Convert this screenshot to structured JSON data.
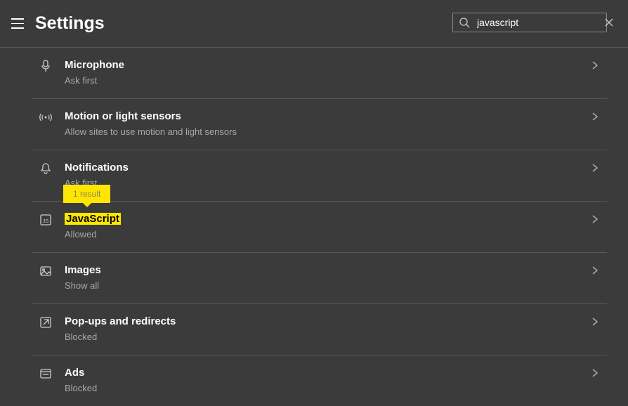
{
  "header": {
    "title": "Settings"
  },
  "search": {
    "value": "javascript"
  },
  "tooltip": {
    "text": "1 result"
  },
  "rows": [
    {
      "title": "Microphone",
      "subtitle": "Ask first"
    },
    {
      "title": "Motion or light sensors",
      "subtitle": "Allow sites to use motion and light sensors"
    },
    {
      "title": "Notifications",
      "subtitle": "Ask first"
    },
    {
      "title": "JavaScript",
      "subtitle": "Allowed"
    },
    {
      "title": "Images",
      "subtitle": "Show all"
    },
    {
      "title": "Pop-ups and redirects",
      "subtitle": "Blocked"
    },
    {
      "title": "Ads",
      "subtitle": "Blocked"
    }
  ]
}
